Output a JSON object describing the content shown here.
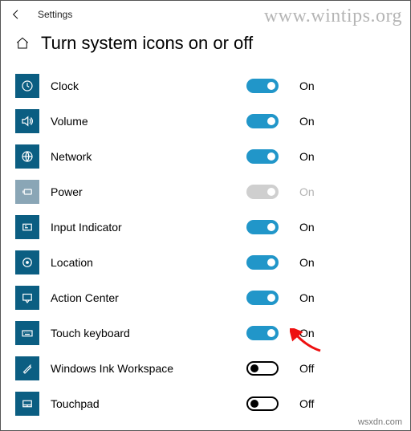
{
  "app_title": "Settings",
  "page_title": "Turn system icons on or off",
  "watermark": "www.wintips.org",
  "footer": "wsxdn.com",
  "state_labels": {
    "on": "On",
    "off": "Off"
  },
  "items": [
    {
      "id": "clock",
      "label": "Clock",
      "state": "on-blue",
      "state_text": "On",
      "icon": "clock"
    },
    {
      "id": "volume",
      "label": "Volume",
      "state": "on-blue",
      "state_text": "On",
      "icon": "volume"
    },
    {
      "id": "network",
      "label": "Network",
      "state": "on-blue",
      "state_text": "On",
      "icon": "network"
    },
    {
      "id": "power",
      "label": "Power",
      "state": "disabled-on",
      "state_text": "On",
      "icon": "power",
      "disabled": true
    },
    {
      "id": "input-indicator",
      "label": "Input Indicator",
      "state": "on-blue",
      "state_text": "On",
      "icon": "input"
    },
    {
      "id": "location",
      "label": "Location",
      "state": "on-blue",
      "state_text": "On",
      "icon": "location"
    },
    {
      "id": "action-center",
      "label": "Action Center",
      "state": "on-blue",
      "state_text": "On",
      "icon": "action"
    },
    {
      "id": "touch-keyboard",
      "label": "Touch keyboard",
      "state": "on-blue",
      "state_text": "On",
      "icon": "keyboard",
      "highlight": true
    },
    {
      "id": "windows-ink",
      "label": "Windows Ink Workspace",
      "state": "off",
      "state_text": "Off",
      "icon": "ink"
    },
    {
      "id": "touchpad",
      "label": "Touchpad",
      "state": "off",
      "state_text": "Off",
      "icon": "touchpad"
    }
  ]
}
